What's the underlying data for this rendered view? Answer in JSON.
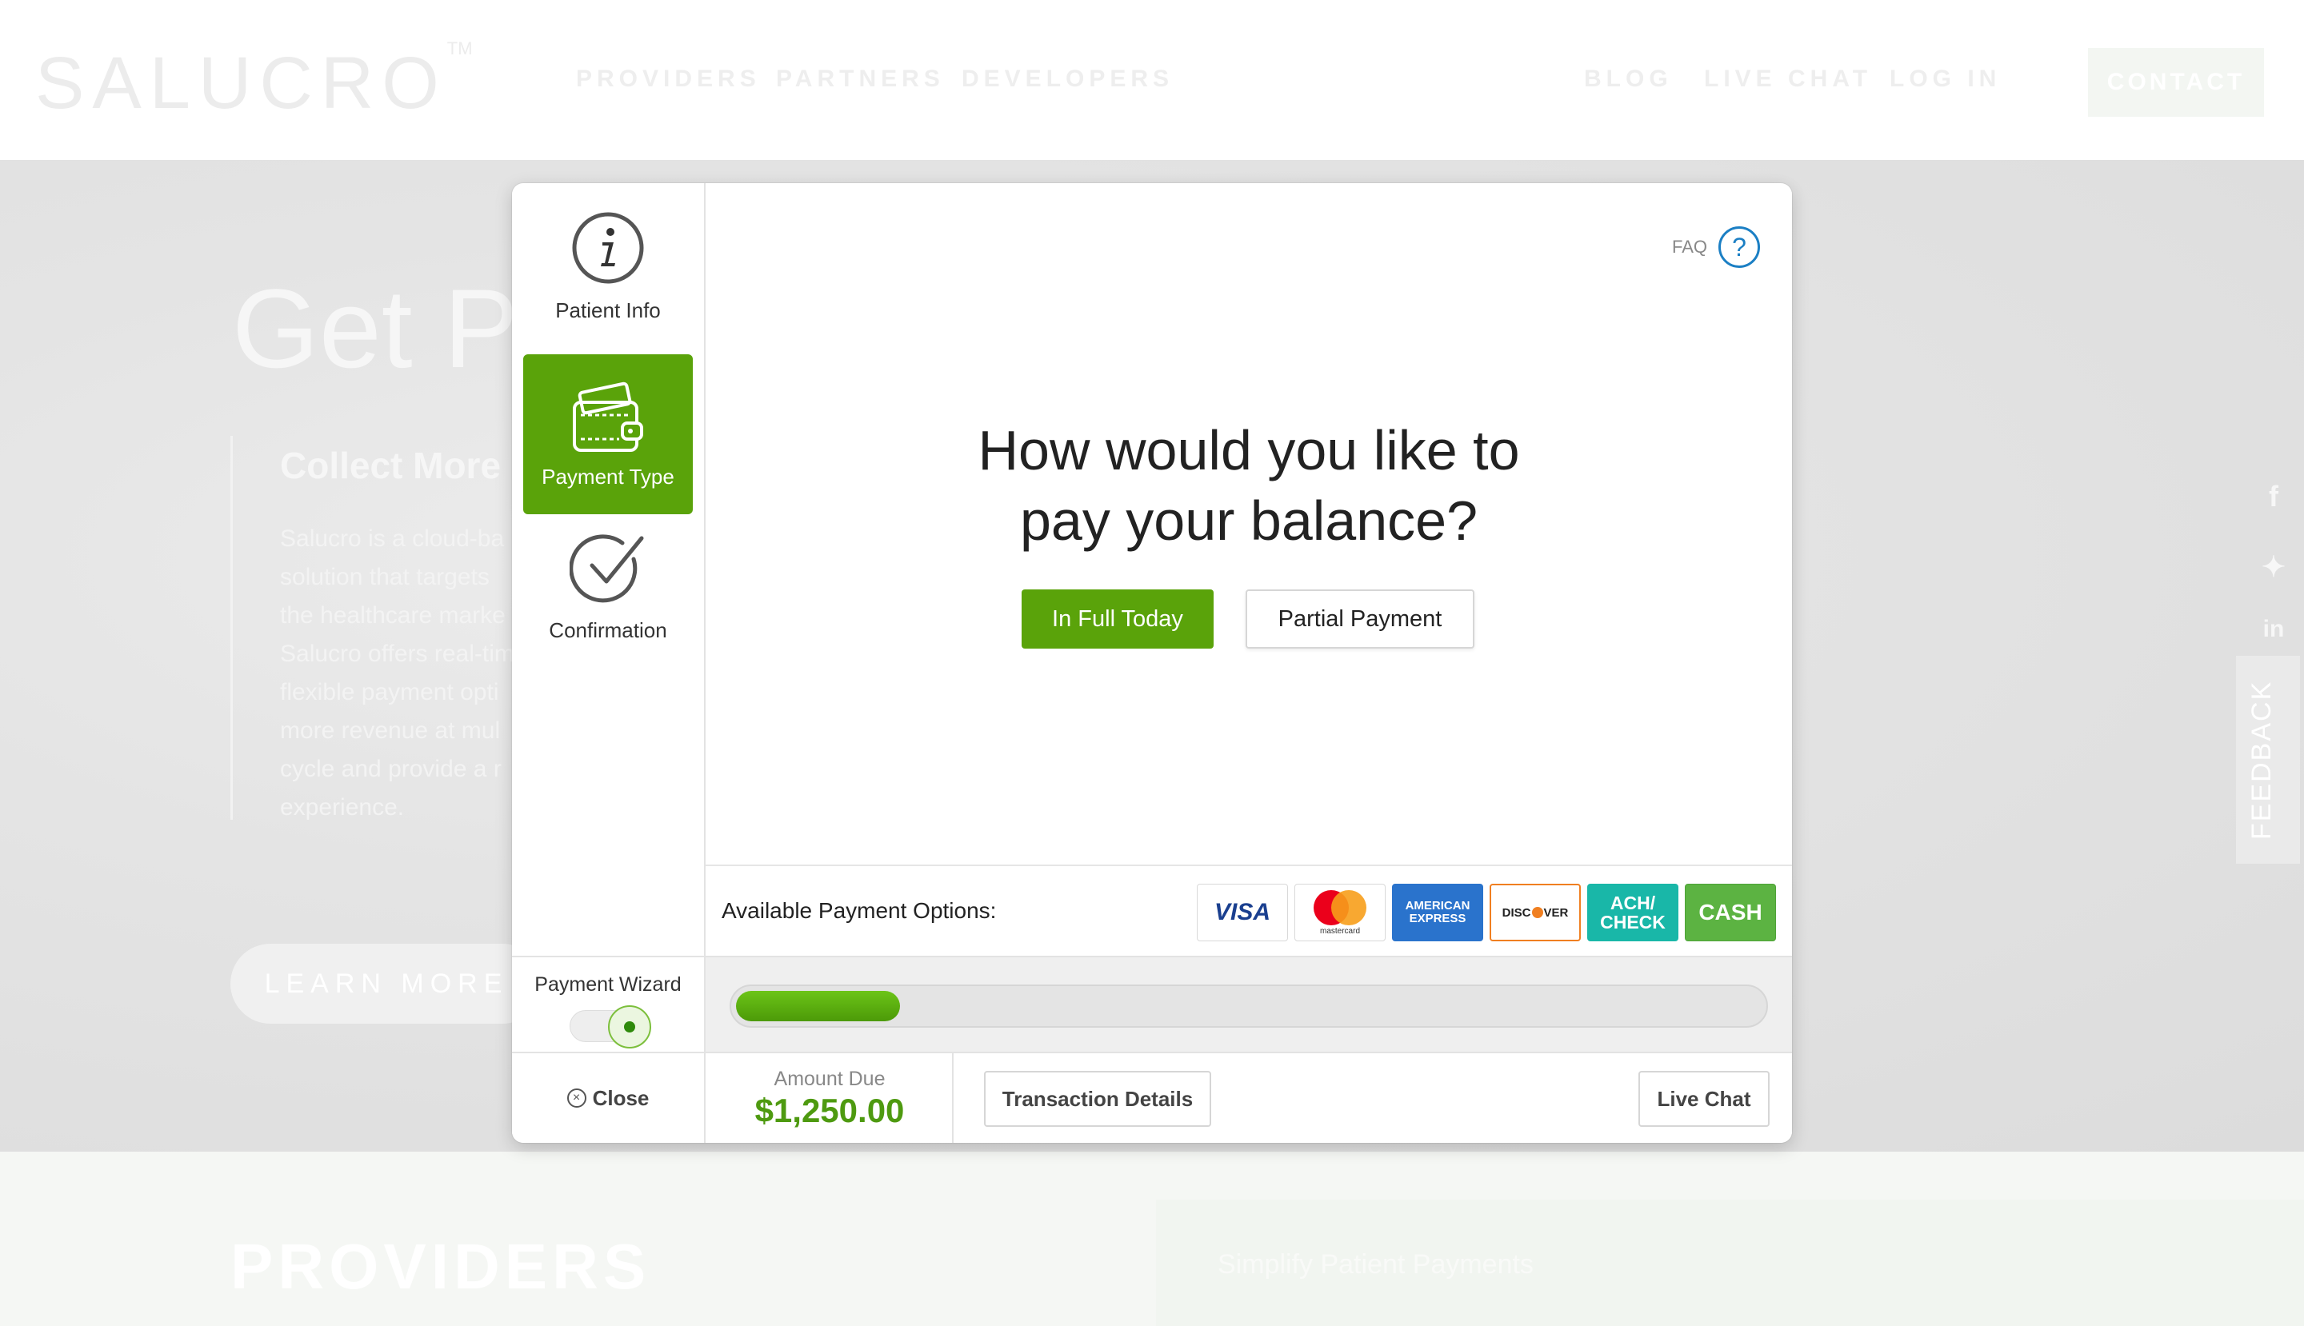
{
  "site": {
    "logo": "SALUCRO",
    "logo_tm": "TM",
    "nav_left": [
      "PROVIDERS",
      "PARTNERS",
      "DEVELOPERS"
    ],
    "nav_right": [
      "BLOG",
      "LIVE CHAT",
      "LOG IN"
    ],
    "contact_label": "CONTACT",
    "hero_title": "Get Pa",
    "hero_subtitle": "Collect More",
    "hero_body": [
      "Salucro is a cloud-ba",
      "solution that targets",
      "the healthcare marke",
      "Salucro offers real-tim",
      "flexible payment opti",
      "more revenue at mul",
      "cycle and provide a r",
      "experience."
    ],
    "learn_more_label": "LEARN MORE",
    "social_icons": [
      "facebook-icon",
      "twitter-icon",
      "linkedin-icon"
    ],
    "feedback_label": "FEEDBACK",
    "providers_heading": "PROVIDERS",
    "simplify_text": "Simplify Patient Payments"
  },
  "modal": {
    "steps": [
      {
        "label": "Patient Info",
        "icon": "info-icon",
        "active": false
      },
      {
        "label": "Payment Type",
        "icon": "wallet-icon",
        "active": true
      },
      {
        "label": "Confirmation",
        "icon": "checkmark-icon",
        "active": false
      }
    ],
    "faq_label": "FAQ",
    "question_line1": "How would you like to",
    "question_line2": "pay your balance?",
    "in_full_label": "In Full Today",
    "partial_label": "Partial Payment",
    "options_label": "Available Payment Options:",
    "cards": {
      "visa": "VISA",
      "mastercard": "mastercard",
      "amex_line1": "AMERICAN",
      "amex_line2": "EXPRESS",
      "discover_pre": "DISC",
      "discover_post": "VER",
      "ach_line1": "ACH/",
      "ach_line2": "CHECK",
      "cash": "CASH"
    },
    "wizard_label": "Payment Wizard",
    "wizard_on": true,
    "progress_fraction": 0.16,
    "close_label": "Close",
    "amount_label": "Amount Due",
    "amount_value": "$1,250.00",
    "transaction_details_label": "Transaction Details",
    "live_chat_label": "Live Chat"
  },
  "colors": {
    "brand_green": "#5aa30a",
    "faq_blue": "#1b7fc4",
    "amount_green": "#4e9a10"
  }
}
